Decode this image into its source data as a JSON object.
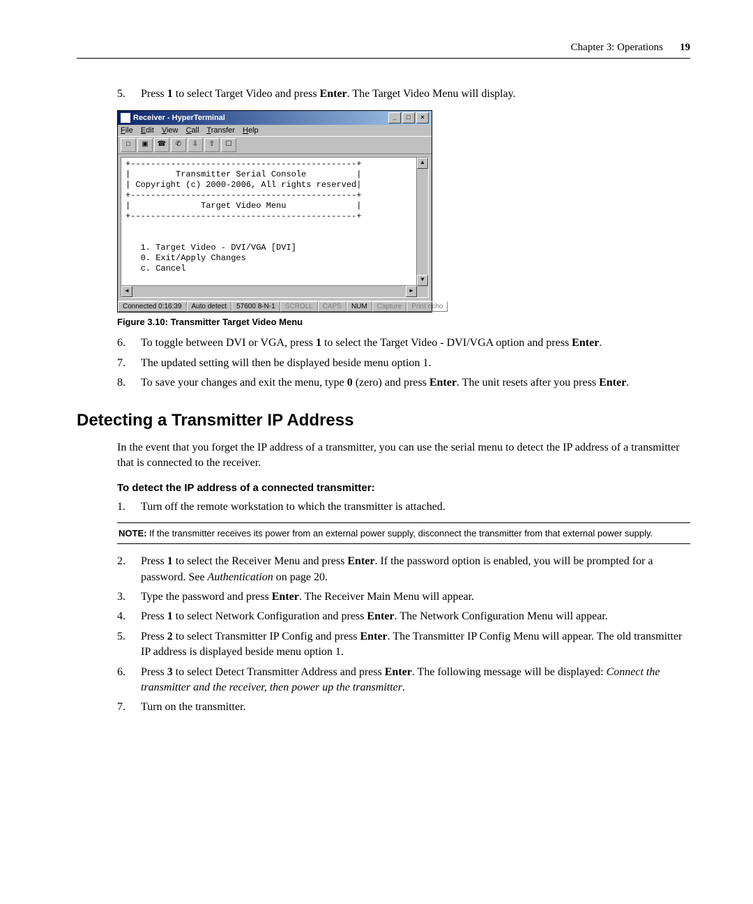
{
  "header": {
    "chapter": "Chapter 3: Operations",
    "page": "19"
  },
  "step5": {
    "num": "5.",
    "t1": "Press ",
    "b1": "1",
    "t2": " to select Target Video and press ",
    "b2": "Enter",
    "t3": ". The Target Video Menu will display."
  },
  "ht": {
    "title": "Receiver - HyperTerminal",
    "menu": {
      "file": "File",
      "edit": "Edit",
      "view": "View",
      "call": "Call",
      "transfer": "Transfer",
      "help": "Help"
    },
    "win": {
      "min": "_",
      "max": "□",
      "close": "×"
    },
    "term": "+---------------------------------------------+\n|         Transmitter Serial Console          |\n| Copyright (c) 2000-2006, All rights reserved|\n+---------------------------------------------+\n|              Target Video Menu              |\n+---------------------------------------------+\n\n\n   1. Target Video - DVI/VGA [DVI]\n   0. Exit/Apply Changes\n   c. Cancel\n\n  Enter selection ->",
    "status": {
      "conn": "Connected 0:16:39",
      "detect": "Auto detect",
      "comm": "57600 8-N-1",
      "scroll": "SCROLL",
      "caps": "CAPS",
      "num": "NUM",
      "capture": "Capture",
      "echo": "Print echo"
    }
  },
  "caption": "Figure 3.10: Transmitter Target Video Menu",
  "step6": {
    "num": "6.",
    "t1": "To toggle between DVI or VGA, press ",
    "b1": "1",
    "t2": " to select the Target Video - DVI/VGA option and press ",
    "b2": "Enter",
    "t3": "."
  },
  "step7": {
    "num": "7.",
    "t1": "The updated setting will then be displayed beside menu option 1."
  },
  "step8": {
    "num": "8.",
    "t1": "To save your changes and exit the menu, type ",
    "b1": "0",
    "t2": " (zero) and press ",
    "b2": "Enter",
    "t3": ". The unit resets after you press ",
    "b3": "Enter",
    "t4": "."
  },
  "section2": "Detecting a Transmitter IP Address",
  "para1": "In the event that you forget the IP address of a transmitter, you can use the serial menu to detect the IP address of a transmitter that is connected to the receiver.",
  "sub1": "To detect the IP address of a connected transmitter:",
  "d1": {
    "num": "1.",
    "t1": "Turn off the remote workstation to which the transmitter is attached."
  },
  "note": {
    "label": "NOTE:",
    "text": " If the transmitter receives its power from an external power supply, disconnect the transmitter from that external power supply."
  },
  "d2": {
    "num": "2.",
    "t1": "Press ",
    "b1": "1",
    "t2": " to select the Receiver Menu and press ",
    "b2": "Enter",
    "t3": ". If the password option is enabled, you will be prompted for a password. See ",
    "i1": "Authentication",
    "t4": " on page 20."
  },
  "d3": {
    "num": "3.",
    "t1": "Type the password and press ",
    "b1": "Enter",
    "t2": ". The Receiver Main Menu will appear."
  },
  "d4": {
    "num": "4.",
    "t1": "Press ",
    "b1": "1",
    "t2": " to select Network Configuration and press ",
    "b2": "Enter",
    "t3": ". The Network Configuration Menu will appear."
  },
  "d5": {
    "num": "5.",
    "t1": "Press ",
    "b1": "2",
    "t2": " to select Transmitter IP Config and press ",
    "b2": "Enter",
    "t3": ". The Transmitter IP Config Menu will appear. The old transmitter IP address is displayed beside menu option 1."
  },
  "d6": {
    "num": "6.",
    "t1": "Press ",
    "b1": "3",
    "t2": " to select Detect Transmitter Address and press ",
    "b2": "Enter",
    "t3": ". The following message will be displayed: ",
    "i1": "Connect the transmitter and the receiver, then power up the transmitter",
    "t4": "."
  },
  "d7": {
    "num": "7.",
    "t1": "Turn on the transmitter."
  }
}
